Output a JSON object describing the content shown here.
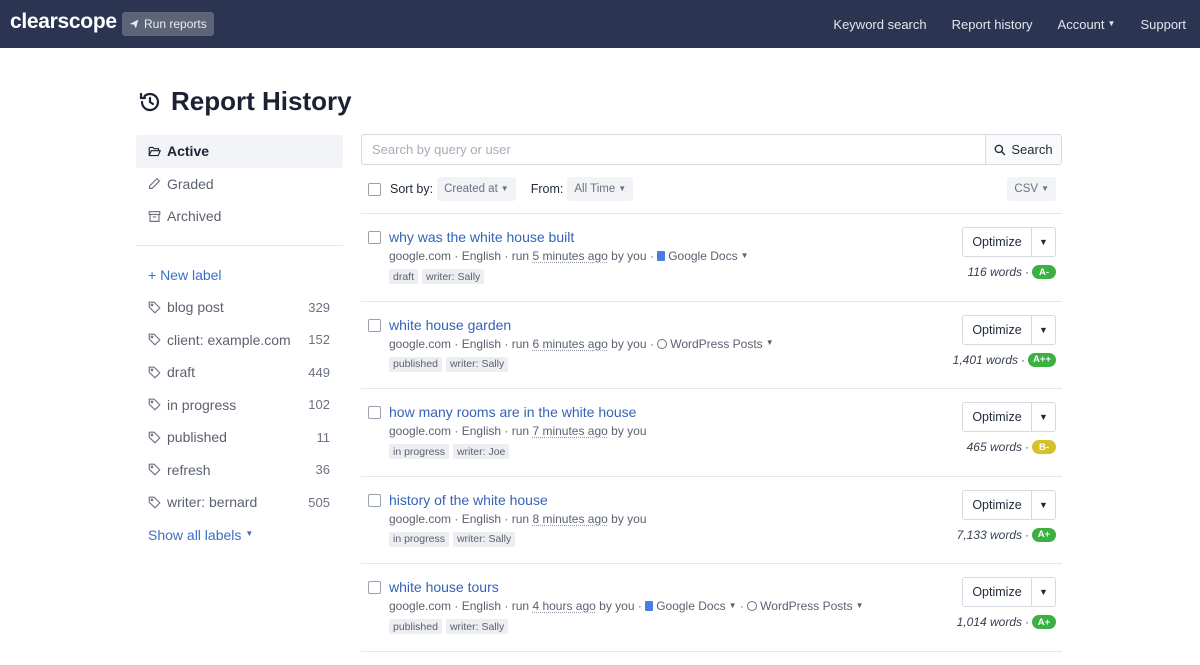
{
  "nav": {
    "logo": "clearscope",
    "run_reports": "Run reports",
    "links": [
      {
        "label": "Keyword search",
        "has_caret": false
      },
      {
        "label": "Report history",
        "has_caret": false
      },
      {
        "label": "Account",
        "has_caret": true
      },
      {
        "label": "Support",
        "has_caret": false
      }
    ]
  },
  "page": {
    "title": "Report History"
  },
  "sidebar": {
    "statuses": [
      {
        "label": "Active",
        "icon": "folder-open-icon",
        "active": true
      },
      {
        "label": "Graded",
        "icon": "pencil-icon",
        "active": false
      },
      {
        "label": "Archived",
        "icon": "archive-icon",
        "active": false
      }
    ],
    "new_label": "+ New label",
    "labels": [
      {
        "name": "blog post",
        "count": "329"
      },
      {
        "name": "client: example.com",
        "count": "152"
      },
      {
        "name": "draft",
        "count": "449"
      },
      {
        "name": "in progress",
        "count": "102"
      },
      {
        "name": "published",
        "count": "11"
      },
      {
        "name": "refresh",
        "count": "36"
      },
      {
        "name": "writer: bernard",
        "count": "505"
      }
    ],
    "show_all": "Show all labels"
  },
  "search": {
    "placeholder": "Search by query or user",
    "button": "Search"
  },
  "sort": {
    "sort_by_label": "Sort by:",
    "sort_by_value": "Created at",
    "from_label": "From:",
    "from_value": "All Time",
    "csv": "CSV"
  },
  "colors": {
    "navbar": "#2b3552",
    "link": "#3563b8",
    "grade_green": "#3cb043",
    "grade_yellow": "#d4c22c"
  },
  "reports": [
    {
      "title": "why was the white house built",
      "domain": "google.com",
      "language": "English",
      "run_prefix": "run",
      "run_time": "5 minutes ago",
      "run_by": "by you",
      "integrations": [
        "Google Docs"
      ],
      "tags": [
        "draft",
        "writer: Sally"
      ],
      "optimize": "Optimize",
      "words": "116 words",
      "grade": "A-",
      "grade_color": "green"
    },
    {
      "title": "white house garden",
      "domain": "google.com",
      "language": "English",
      "run_prefix": "run",
      "run_time": "6 minutes ago",
      "run_by": "by you",
      "integrations": [
        "WordPress Posts"
      ],
      "tags": [
        "published",
        "writer: Sally"
      ],
      "optimize": "Optimize",
      "words": "1,401 words",
      "grade": "A++",
      "grade_color": "green"
    },
    {
      "title": "how many rooms are in the white house",
      "domain": "google.com",
      "language": "English",
      "run_prefix": "run",
      "run_time": "7 minutes ago",
      "run_by": "by you",
      "integrations": [],
      "tags": [
        "in progress",
        "writer: Joe"
      ],
      "optimize": "Optimize",
      "words": "465 words",
      "grade": "B-",
      "grade_color": "yellow"
    },
    {
      "title": "history of the white house",
      "domain": "google.com",
      "language": "English",
      "run_prefix": "run",
      "run_time": "8 minutes ago",
      "run_by": "by you",
      "integrations": [],
      "tags": [
        "in progress",
        "writer: Sally"
      ],
      "optimize": "Optimize",
      "words": "7,133 words",
      "grade": "A+",
      "grade_color": "green"
    },
    {
      "title": "white house tours",
      "domain": "google.com",
      "language": "English",
      "run_prefix": "run",
      "run_time": "4 hours ago",
      "run_by": "by you",
      "integrations": [
        "Google Docs",
        "WordPress Posts"
      ],
      "tags": [
        "published",
        "writer: Sally"
      ],
      "optimize": "Optimize",
      "words": "1,014 words",
      "grade": "A+",
      "grade_color": "green"
    }
  ]
}
